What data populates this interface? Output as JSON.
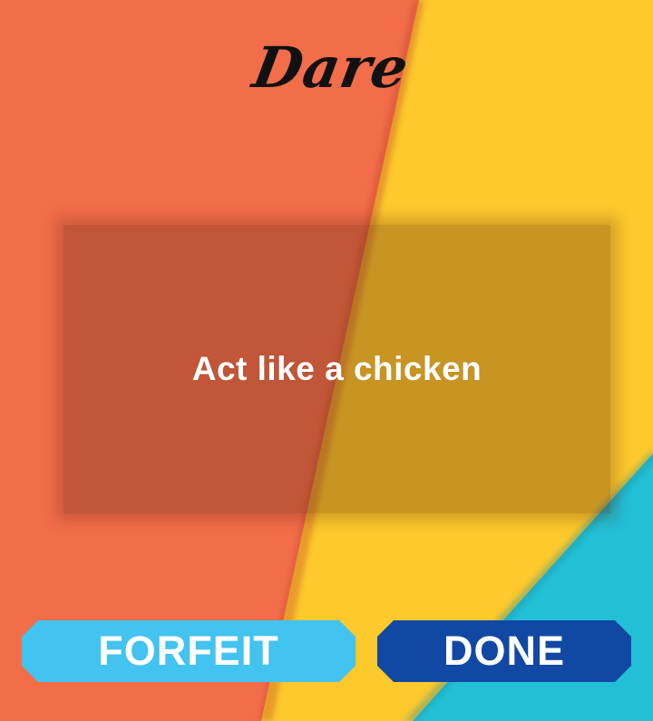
{
  "title": "Dare",
  "dare_text": "Act like a chicken",
  "buttons": {
    "forfeit_label": "FORFEIT",
    "done_label": "DONE"
  },
  "colors": {
    "background_orange": "#f26d4a",
    "background_yellow": "#fdc92c",
    "background_teal": "#22bfd6",
    "forfeit_button": "#42c3f0",
    "done_button": "#1148a3",
    "text": "#ffffff",
    "title": "#111111"
  }
}
